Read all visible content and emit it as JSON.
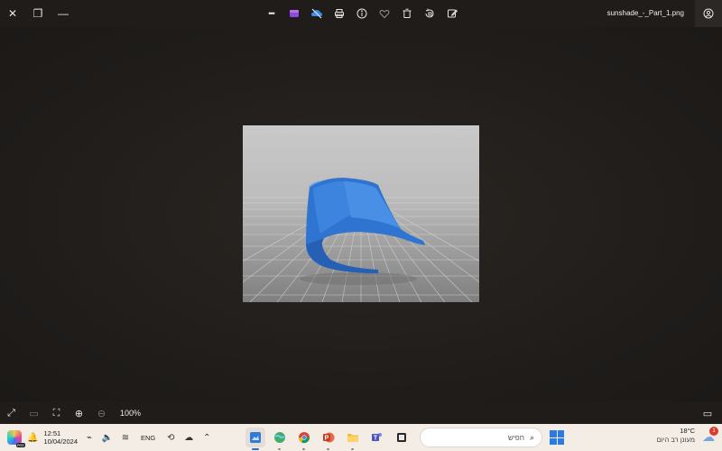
{
  "window": {
    "filename": "sunshade_-_Part_1.png",
    "controls": [
      "close",
      "restore",
      "minimize"
    ]
  },
  "toolbar": {
    "items": [
      {
        "name": "more-options-icon",
        "glyph": "•••"
      },
      {
        "name": "clipchamp-icon",
        "glyph": "▣"
      },
      {
        "name": "onedrive-off-icon",
        "glyph": "☁"
      },
      {
        "name": "print-icon",
        "glyph": "⎙"
      },
      {
        "name": "info-icon",
        "glyph": "ⓘ"
      },
      {
        "name": "favorite-icon",
        "glyph": "♡"
      },
      {
        "name": "delete-icon",
        "glyph": "🗑"
      },
      {
        "name": "rotate-icon",
        "glyph": "↻"
      },
      {
        "name": "edit-icon",
        "glyph": "✎"
      }
    ]
  },
  "viewer": {
    "zoom": "100%"
  },
  "taskbar": {
    "time": "12:51",
    "date": "10/04/2024",
    "language": "ENG",
    "search_placeholder": "חפיש",
    "weather_temp": "18°C",
    "weather_desc": "מעונן רב היום",
    "notification_count": "1",
    "copilot_badge": "PRE"
  },
  "colors": {
    "background": "#1e1b19",
    "taskbar": "#f3ede6",
    "accent": "#2b6fd6",
    "model_blue": "#2f74d0"
  }
}
